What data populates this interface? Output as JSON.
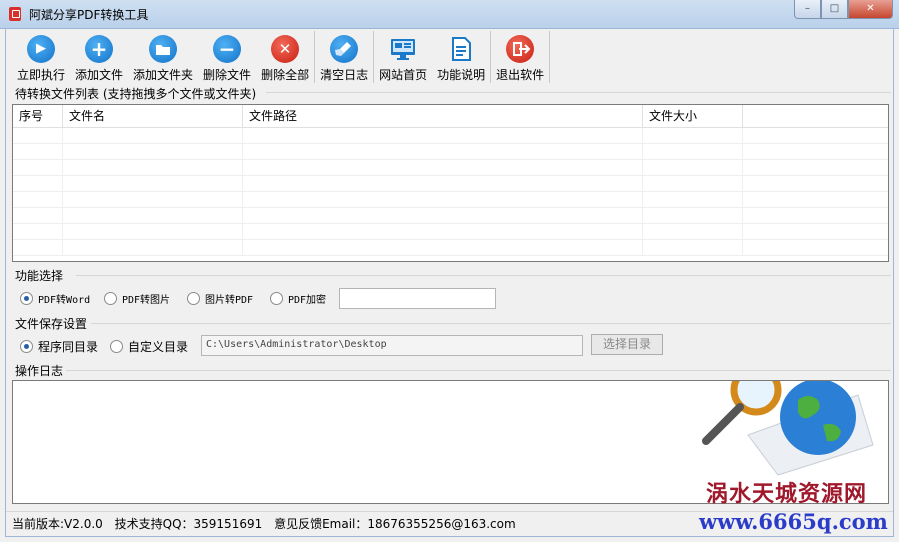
{
  "window": {
    "title": "阿斌分享PDF转换工具",
    "minimize": "–",
    "maximize": "□",
    "close": "✕"
  },
  "toolbar": {
    "run": "立即执行",
    "add_file": "添加文件",
    "add_folder": "添加文件夹",
    "delete_file": "删除文件",
    "delete_all": "删除全部",
    "clear_log": "清空日志",
    "homepage": "网站首页",
    "help": "功能说明",
    "exit": "退出软件"
  },
  "file_list": {
    "label": "待转换文件列表 (支持拖拽多个文件或文件夹)",
    "columns": [
      "序号",
      "文件名",
      "文件路径",
      "文件大小",
      ""
    ]
  },
  "function_select": {
    "label": "功能选择",
    "options": [
      "PDF转Word",
      "PDF转图片",
      "图片转PDF",
      "PDF加密"
    ],
    "selected": "PDF转Word",
    "password_value": ""
  },
  "save_settings": {
    "label": "文件保存设置",
    "options": [
      "程序同目录",
      "自定义目录"
    ],
    "selected": "程序同目录",
    "path": "C:\\Users\\Administrator\\Desktop",
    "choose_dir": "选择目录"
  },
  "log": {
    "label": "操作日志"
  },
  "status": {
    "version": "当前版本:V2.0.0",
    "qq": "技术支持QQ：359151691",
    "email": "意见反馈Email：18676355256@163.com"
  },
  "watermark": {
    "line1": "涡水天城资源网",
    "line2": "www.6665q.com"
  },
  "colors": {
    "accent_blue": "#1272c8",
    "accent_red": "#c81e10",
    "titlebar": "#b9d1ea"
  }
}
